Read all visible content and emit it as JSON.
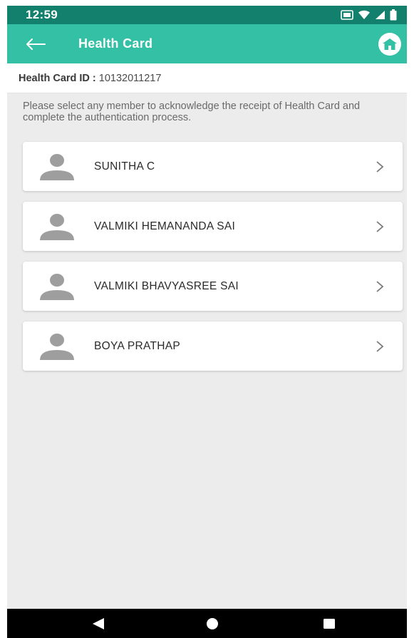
{
  "status_bar": {
    "time": "12:59",
    "icons": [
      "data-saver-icon",
      "wifi-icon",
      "signal-icon",
      "battery-icon"
    ]
  },
  "app_bar": {
    "title": "Health Card",
    "back_icon": "arrow-left-icon",
    "home_icon": "home-icon"
  },
  "health_card": {
    "id_label": "Health Card ID :",
    "id_value": "10132011217"
  },
  "instructions": "Please select any member to acknowledge the receipt of Health Card and complete the authentication process.",
  "members": [
    {
      "name": "SUNITHA C"
    },
    {
      "name": "VALMIKI HEMANANDA SAI"
    },
    {
      "name": "VALMIKI BHAVYASREE SAI"
    },
    {
      "name": "BOYA PRATHAP"
    }
  ],
  "nav_bar": {
    "buttons": [
      "back-triangle-icon",
      "home-circle-icon",
      "recents-square-icon"
    ]
  },
  "colors": {
    "status_bar": "#12806c",
    "app_bar": "#33c0a4",
    "content_bg": "#ececec",
    "avatar": "#9e9e9e"
  }
}
